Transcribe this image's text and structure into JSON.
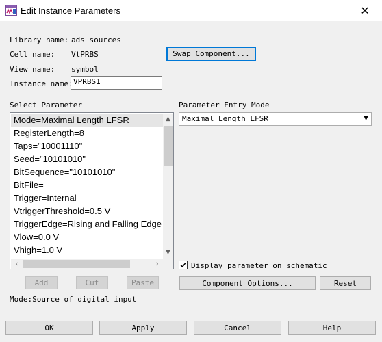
{
  "window": {
    "title": "Edit Instance Parameters",
    "close_glyph": "✕",
    "app_icon": "ads-app-icon"
  },
  "info": {
    "library_label": "Library name:",
    "library_value": "ads_sources",
    "cell_label": "Cell name:",
    "cell_value": "VtPRBS",
    "view_label": "View name:",
    "view_value": "symbol",
    "instance_label": "Instance name:",
    "instance_value": "VPRBS1"
  },
  "swap_button": "Swap Component...",
  "select_parameter": {
    "label": "Select Parameter",
    "items": [
      "Mode=Maximal Length LFSR",
      "RegisterLength=8",
      "Taps=\"10001110\"",
      "Seed=\"10101010\"",
      "BitSequence=\"10101010\"",
      "BitFile=",
      "Trigger=Internal",
      "VtriggerThreshold=0.5 V",
      "TriggerEdge=Rising and Falling Edge",
      "Vlow=0.0 V",
      "Vhigh=1.0 V"
    ],
    "selected_index": 0
  },
  "entry_mode": {
    "label": "Parameter Entry Mode",
    "value": "Maximal Length LFSR"
  },
  "display_param": {
    "label": "Display parameter on schematic",
    "checked": true
  },
  "list_buttons": {
    "add": "Add",
    "cut": "Cut",
    "paste": "Paste"
  },
  "component_options": "Component Options...",
  "reset": "Reset",
  "status": "Mode:Source of digital input",
  "footer": {
    "ok": "OK",
    "apply": "Apply",
    "cancel": "Cancel",
    "help": "Help"
  }
}
